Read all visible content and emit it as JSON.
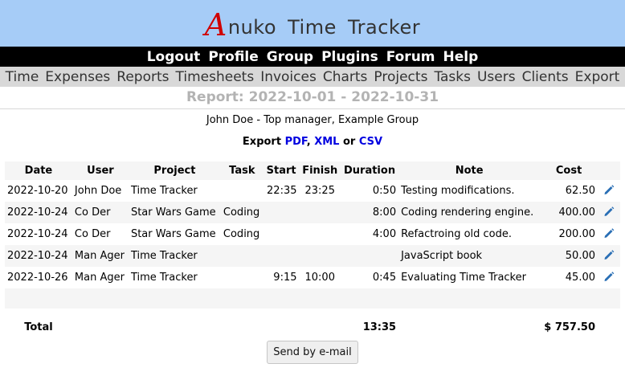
{
  "header": {
    "logo_letter": "A",
    "logo_text": "nuko Time Tracker"
  },
  "topnav": [
    "Logout",
    "Profile",
    "Group",
    "Plugins",
    "Forum",
    "Help"
  ],
  "subnav": [
    "Time",
    "Expenses",
    "Reports",
    "Timesheets",
    "Invoices",
    "Charts",
    "Projects",
    "Tasks",
    "Users",
    "Clients",
    "Export"
  ],
  "report": {
    "title": "Report: 2022-10-01 - 2022-10-31",
    "user_line": "John Doe - Top manager, Example Group",
    "export": {
      "prefix": "Export",
      "pdf": "PDF",
      "sep1": ",",
      "xml": "XML",
      "or": "or",
      "csv": "CSV"
    },
    "columns": [
      "Date",
      "User",
      "Project",
      "Task",
      "Start",
      "Finish",
      "Duration",
      "Note",
      "Cost"
    ],
    "rows": [
      [
        "2022-10-20",
        "John Doe",
        "Time Tracker",
        "",
        "22:35",
        "23:25",
        "0:50",
        "Testing modifications.",
        "62.50"
      ],
      [
        "2022-10-24",
        "Co Der",
        "Star Wars Game",
        "Coding",
        "",
        "",
        "8:00",
        "Coding rendering engine.",
        "400.00"
      ],
      [
        "2022-10-24",
        "Co Der",
        "Star Wars Game",
        "Coding",
        "",
        "",
        "4:00",
        "Refactroing old code.",
        "200.00"
      ],
      [
        "2022-10-24",
        "Man Ager",
        "Time Tracker",
        "",
        "",
        "",
        "",
        "JavaScript book",
        "50.00"
      ],
      [
        "2022-10-26",
        "Man Ager",
        "Time Tracker",
        "",
        "9:15",
        "10:00",
        "0:45",
        "Evaluating Time Tracker",
        "45.00"
      ]
    ],
    "total": {
      "label": "Total",
      "duration": "13:35",
      "cost": "$ 757.50"
    },
    "send_button": "Send by e-mail"
  },
  "colors": {
    "header_bg": "#a6ccf7",
    "nav_bg": "#000000",
    "subnav_bg": "#d8d8d8",
    "link": "#0000e0",
    "logo_accent": "#d00000",
    "pencil": "#2a6fb5"
  },
  "icons": {
    "row_edit": "pencil-icon"
  }
}
